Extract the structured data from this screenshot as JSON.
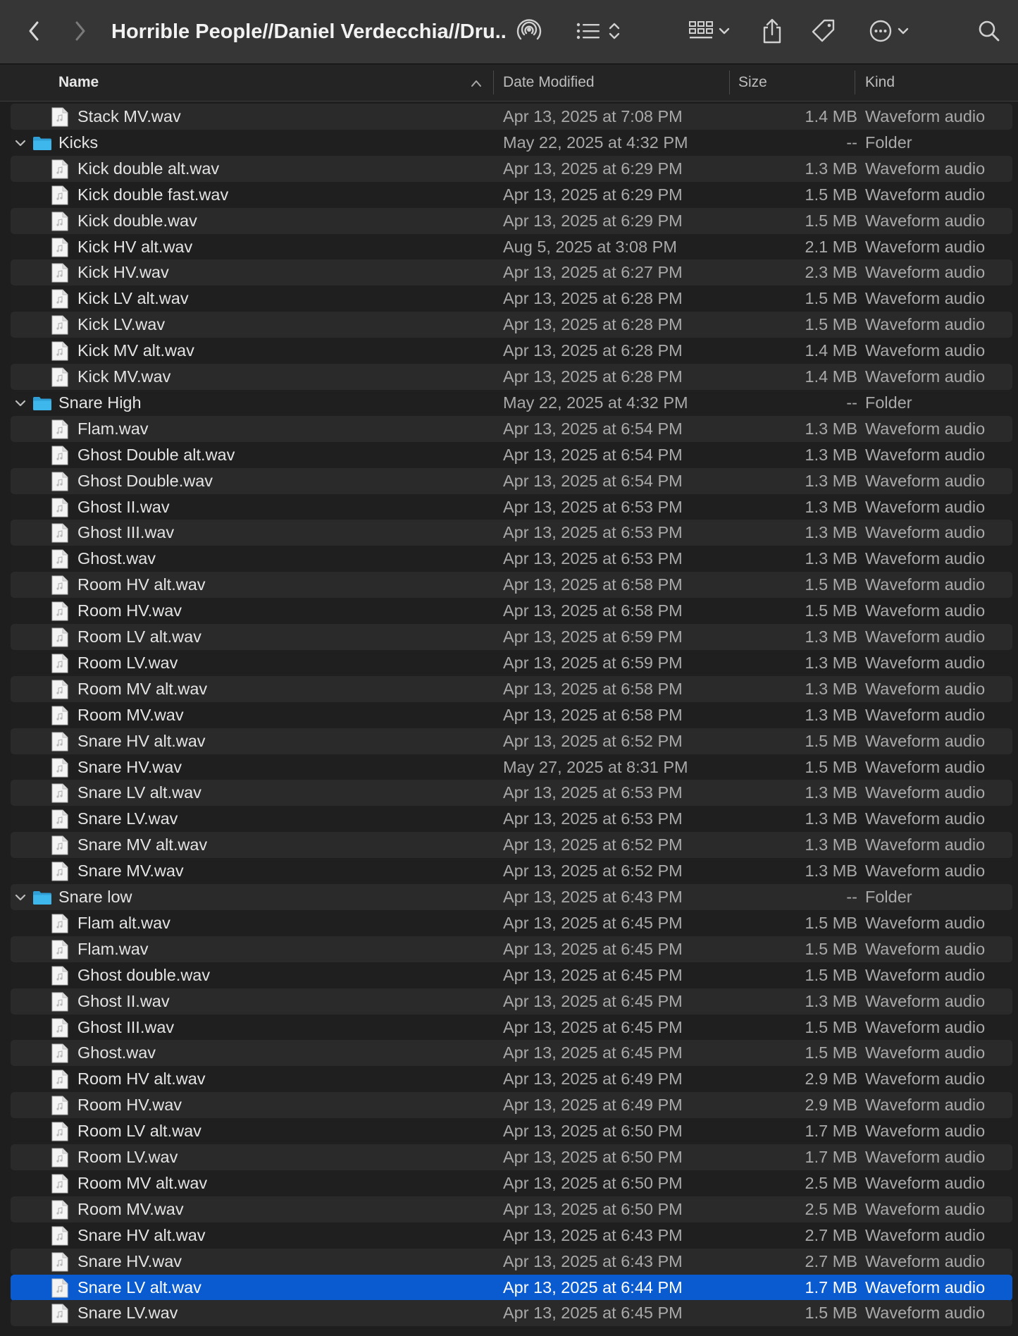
{
  "window": {
    "title": "Horrible People//Daniel Verdecchia//Dru...",
    "icons": [
      "back-icon",
      "forward-icon",
      "airdrop-icon",
      "list-view-icon",
      "sort-chevrons-icon",
      "grid-view-icon",
      "chevron-down-icon",
      "share-icon",
      "tag-icon",
      "more-icon",
      "search-icon"
    ]
  },
  "columns": {
    "name": "Name",
    "date": "Date Modified",
    "size": "Size",
    "kind": "Kind"
  },
  "colors": {
    "selection": "#0a5bd0",
    "folder": "#3eb8ec"
  },
  "rows": [
    {
      "type": "file",
      "indent": 1,
      "name": "Stack MV.wav",
      "date": "Apr 13, 2025 at 7:08 PM",
      "size": "1.4 MB",
      "kind": "Waveform audio"
    },
    {
      "type": "folder",
      "indent": 0,
      "name": "Kicks",
      "date": "May 22, 2025 at 4:32 PM",
      "size": "--",
      "kind": "Folder"
    },
    {
      "type": "file",
      "indent": 1,
      "name": "Kick double alt.wav",
      "date": "Apr 13, 2025 at 6:29 PM",
      "size": "1.3 MB",
      "kind": "Waveform audio"
    },
    {
      "type": "file",
      "indent": 1,
      "name": "Kick double fast.wav",
      "date": "Apr 13, 2025 at 6:29 PM",
      "size": "1.5 MB",
      "kind": "Waveform audio"
    },
    {
      "type": "file",
      "indent": 1,
      "name": "Kick double.wav",
      "date": "Apr 13, 2025 at 6:29 PM",
      "size": "1.5 MB",
      "kind": "Waveform audio"
    },
    {
      "type": "file",
      "indent": 1,
      "name": "Kick HV alt.wav",
      "date": "Aug 5, 2025 at 3:08 PM",
      "size": "2.1 MB",
      "kind": "Waveform audio"
    },
    {
      "type": "file",
      "indent": 1,
      "name": "Kick HV.wav",
      "date": "Apr 13, 2025 at 6:27 PM",
      "size": "2.3 MB",
      "kind": "Waveform audio"
    },
    {
      "type": "file",
      "indent": 1,
      "name": "Kick LV alt.wav",
      "date": "Apr 13, 2025 at 6:28 PM",
      "size": "1.5 MB",
      "kind": "Waveform audio"
    },
    {
      "type": "file",
      "indent": 1,
      "name": "Kick LV.wav",
      "date": "Apr 13, 2025 at 6:28 PM",
      "size": "1.5 MB",
      "kind": "Waveform audio"
    },
    {
      "type": "file",
      "indent": 1,
      "name": "Kick MV alt.wav",
      "date": "Apr 13, 2025 at 6:28 PM",
      "size": "1.4 MB",
      "kind": "Waveform audio"
    },
    {
      "type": "file",
      "indent": 1,
      "name": "Kick MV.wav",
      "date": "Apr 13, 2025 at 6:28 PM",
      "size": "1.4 MB",
      "kind": "Waveform audio"
    },
    {
      "type": "folder",
      "indent": 0,
      "name": "Snare High",
      "date": "May 22, 2025 at 4:32 PM",
      "size": "--",
      "kind": "Folder"
    },
    {
      "type": "file",
      "indent": 1,
      "name": "Flam.wav",
      "date": "Apr 13, 2025 at 6:54 PM",
      "size": "1.3 MB",
      "kind": "Waveform audio"
    },
    {
      "type": "file",
      "indent": 1,
      "name": "Ghost Double alt.wav",
      "date": "Apr 13, 2025 at 6:54 PM",
      "size": "1.3 MB",
      "kind": "Waveform audio"
    },
    {
      "type": "file",
      "indent": 1,
      "name": "Ghost Double.wav",
      "date": "Apr 13, 2025 at 6:54 PM",
      "size": "1.3 MB",
      "kind": "Waveform audio"
    },
    {
      "type": "file",
      "indent": 1,
      "name": "Ghost II.wav",
      "date": "Apr 13, 2025 at 6:53 PM",
      "size": "1.3 MB",
      "kind": "Waveform audio"
    },
    {
      "type": "file",
      "indent": 1,
      "name": "Ghost III.wav",
      "date": "Apr 13, 2025 at 6:53 PM",
      "size": "1.3 MB",
      "kind": "Waveform audio"
    },
    {
      "type": "file",
      "indent": 1,
      "name": "Ghost.wav",
      "date": "Apr 13, 2025 at 6:53 PM",
      "size": "1.3 MB",
      "kind": "Waveform audio"
    },
    {
      "type": "file",
      "indent": 1,
      "name": "Room HV alt.wav",
      "date": "Apr 13, 2025 at 6:58 PM",
      "size": "1.5 MB",
      "kind": "Waveform audio"
    },
    {
      "type": "file",
      "indent": 1,
      "name": "Room HV.wav",
      "date": "Apr 13, 2025 at 6:58 PM",
      "size": "1.5 MB",
      "kind": "Waveform audio"
    },
    {
      "type": "file",
      "indent": 1,
      "name": "Room LV alt.wav",
      "date": "Apr 13, 2025 at 6:59 PM",
      "size": "1.3 MB",
      "kind": "Waveform audio"
    },
    {
      "type": "file",
      "indent": 1,
      "name": "Room LV.wav",
      "date": "Apr 13, 2025 at 6:59 PM",
      "size": "1.3 MB",
      "kind": "Waveform audio"
    },
    {
      "type": "file",
      "indent": 1,
      "name": "Room MV alt.wav",
      "date": "Apr 13, 2025 at 6:58 PM",
      "size": "1.3 MB",
      "kind": "Waveform audio"
    },
    {
      "type": "file",
      "indent": 1,
      "name": "Room MV.wav",
      "date": "Apr 13, 2025 at 6:58 PM",
      "size": "1.3 MB",
      "kind": "Waveform audio"
    },
    {
      "type": "file",
      "indent": 1,
      "name": "Snare HV alt.wav",
      "date": "Apr 13, 2025 at 6:52 PM",
      "size": "1.5 MB",
      "kind": "Waveform audio"
    },
    {
      "type": "file",
      "indent": 1,
      "name": "Snare HV.wav",
      "date": "May 27, 2025 at 8:31 PM",
      "size": "1.5 MB",
      "kind": "Waveform audio"
    },
    {
      "type": "file",
      "indent": 1,
      "name": "Snare LV alt.wav",
      "date": "Apr 13, 2025 at 6:53 PM",
      "size": "1.3 MB",
      "kind": "Waveform audio"
    },
    {
      "type": "file",
      "indent": 1,
      "name": "Snare LV.wav",
      "date": "Apr 13, 2025 at 6:53 PM",
      "size": "1.3 MB",
      "kind": "Waveform audio"
    },
    {
      "type": "file",
      "indent": 1,
      "name": "Snare MV alt.wav",
      "date": "Apr 13, 2025 at 6:52 PM",
      "size": "1.3 MB",
      "kind": "Waveform audio"
    },
    {
      "type": "file",
      "indent": 1,
      "name": "Snare MV.wav",
      "date": "Apr 13, 2025 at 6:52 PM",
      "size": "1.3 MB",
      "kind": "Waveform audio"
    },
    {
      "type": "folder",
      "indent": 0,
      "name": "Snare low",
      "date": "Apr 13, 2025 at 6:43 PM",
      "size": "--",
      "kind": "Folder"
    },
    {
      "type": "file",
      "indent": 1,
      "name": "Flam alt.wav",
      "date": "Apr 13, 2025 at 6:45 PM",
      "size": "1.5 MB",
      "kind": "Waveform audio"
    },
    {
      "type": "file",
      "indent": 1,
      "name": "Flam.wav",
      "date": "Apr 13, 2025 at 6:45 PM",
      "size": "1.5 MB",
      "kind": "Waveform audio"
    },
    {
      "type": "file",
      "indent": 1,
      "name": "Ghost double.wav",
      "date": "Apr 13, 2025 at 6:45 PM",
      "size": "1.5 MB",
      "kind": "Waveform audio"
    },
    {
      "type": "file",
      "indent": 1,
      "name": "Ghost II.wav",
      "date": "Apr 13, 2025 at 6:45 PM",
      "size": "1.3 MB",
      "kind": "Waveform audio"
    },
    {
      "type": "file",
      "indent": 1,
      "name": "Ghost III.wav",
      "date": "Apr 13, 2025 at 6:45 PM",
      "size": "1.5 MB",
      "kind": "Waveform audio"
    },
    {
      "type": "file",
      "indent": 1,
      "name": "Ghost.wav",
      "date": "Apr 13, 2025 at 6:45 PM",
      "size": "1.5 MB",
      "kind": "Waveform audio"
    },
    {
      "type": "file",
      "indent": 1,
      "name": "Room HV alt.wav",
      "date": "Apr 13, 2025 at 6:49 PM",
      "size": "2.9 MB",
      "kind": "Waveform audio"
    },
    {
      "type": "file",
      "indent": 1,
      "name": "Room HV.wav",
      "date": "Apr 13, 2025 at 6:49 PM",
      "size": "2.9 MB",
      "kind": "Waveform audio"
    },
    {
      "type": "file",
      "indent": 1,
      "name": "Room LV alt.wav",
      "date": "Apr 13, 2025 at 6:50 PM",
      "size": "1.7 MB",
      "kind": "Waveform audio"
    },
    {
      "type": "file",
      "indent": 1,
      "name": "Room LV.wav",
      "date": "Apr 13, 2025 at 6:50 PM",
      "size": "1.7 MB",
      "kind": "Waveform audio"
    },
    {
      "type": "file",
      "indent": 1,
      "name": "Room MV alt.wav",
      "date": "Apr 13, 2025 at 6:50 PM",
      "size": "2.5 MB",
      "kind": "Waveform audio"
    },
    {
      "type": "file",
      "indent": 1,
      "name": "Room MV.wav",
      "date": "Apr 13, 2025 at 6:50 PM",
      "size": "2.5 MB",
      "kind": "Waveform audio"
    },
    {
      "type": "file",
      "indent": 1,
      "name": "Snare HV alt.wav",
      "date": "Apr 13, 2025 at 6:43 PM",
      "size": "2.7 MB",
      "kind": "Waveform audio"
    },
    {
      "type": "file",
      "indent": 1,
      "name": "Snare HV.wav",
      "date": "Apr 13, 2025 at 6:43 PM",
      "size": "2.7 MB",
      "kind": "Waveform audio"
    },
    {
      "type": "file",
      "indent": 1,
      "name": "Snare LV alt.wav",
      "date": "Apr 13, 2025 at 6:44 PM",
      "size": "1.7 MB",
      "kind": "Waveform audio",
      "selected": true
    },
    {
      "type": "file",
      "indent": 1,
      "name": "Snare LV.wav",
      "date": "Apr 13, 2025 at 6:45 PM",
      "size": "1.5 MB",
      "kind": "Waveform audio"
    }
  ]
}
